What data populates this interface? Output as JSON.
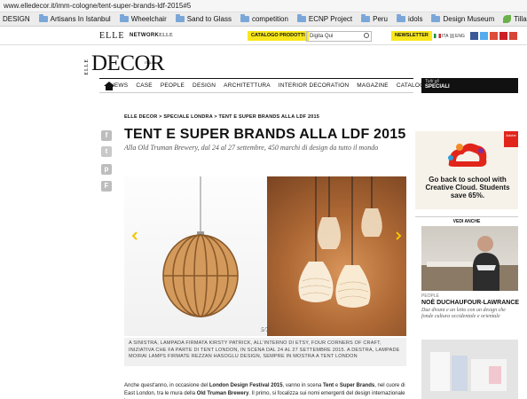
{
  "browser": {
    "url": "www.elledecor.it/imm-cologne/tent-super-brands-ldf-2015#5",
    "bookmarks": [
      "DESIGN",
      "Artisans In Istanbul",
      "Wheelchair",
      "Sand to Glass",
      "competition",
      "ECNP Project",
      "Peru",
      "idols",
      "Design Museum",
      "Tillandsia Caput-Me..."
    ]
  },
  "topbar": {
    "elle": "ELLE",
    "network_a": "NETWORK",
    "network_b": "ELLE",
    "catalog_button": "CATALOGO PRODOTTI",
    "search_placeholder": "Digita Qui",
    "newsletter_button": "NEWSLETTER",
    "lang_ita": "ITA",
    "lang_eng": "ENG"
  },
  "masthead": {
    "elle": "ELLE",
    "decor": "DECOR",
    "italia": "ITALIA"
  },
  "nav": {
    "items": [
      "NEWS",
      "CASE",
      "PEOPLE",
      "DESIGN",
      "ARCHITETTURA",
      "INTERIOR DECORATION",
      "MAGAZINE",
      "CATALOGO"
    ],
    "special_line1": "Tutti gli",
    "special_line2": "SPECIALI"
  },
  "article": {
    "breadcrumb": "ELLE DECOR > SPECIALE LONDRA > TENT E SUPER BRANDS ALLA LDF 2015",
    "title": "TENT E SUPER BRANDS ALLA LDF 2015",
    "subtitle": "Alla Old Truman Brewery, dal 24 al 27 settembre, 450 marchi di design da tutto il mondo",
    "counter": "5/7",
    "caption": "A SINISTRA, LAMPADA FIRMATA KIRSTY PATRICK, ALL'INTERNO DI ETSY, FOUR CORNERS OF CRAFT, INIZIATIVA CHE FA PARTE DI TENT LONDON, IN SCENA DAL 24 AL 27 SETTEMBRE 2015. A DESTRA, LAMPADE MOIRAI LAMPS FIRMATE REZZAN HASOGLU DESIGN, SEMPRE IN MOSTRA A TENT LONDON",
    "body_1": "Anche quest'anno, in occasione del ",
    "body_b1": "London Design Festival 2015",
    "body_2": ", vanno in scena ",
    "body_b2": "Tent",
    "body_3": " e ",
    "body_b3": "Super Brands",
    "body_4": ", nel cuore di East London, tra le mura della ",
    "body_b4": "Old Truman Brewery",
    "body_5": ". Il primo, si focalizza sui nomi emergenti del design internazionale in"
  },
  "ad": {
    "brand": "Adobe",
    "text": "Go back to school with Creative Cloud. Students save 65%."
  },
  "sidebar": {
    "vedi_anche": "VEDI ANCHE",
    "people": "PEOPLE",
    "name": "NOÈ DUCHAUFOUR-LAWRANCE",
    "desc": "Due divani e un letto con un design che fonde cultura occidentale e orientale"
  },
  "colors": {
    "highlight": "#f8e71c",
    "nav_border": "#111111",
    "adobe_red": "#e1251b"
  }
}
